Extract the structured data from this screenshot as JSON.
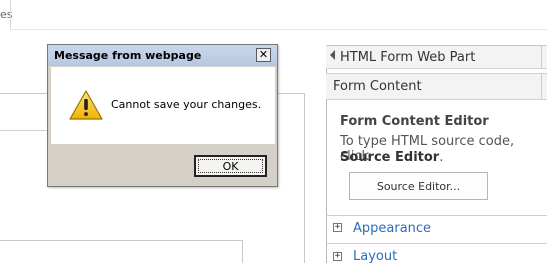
{
  "background": {
    "tab_fragment": "es"
  },
  "tool_pane": {
    "title": "HTML Form Web Part",
    "section_header": "Form Content",
    "editor_title": "Form Content Editor",
    "editor_desc_line1": "To type HTML source code, click",
    "editor_desc_bold": "Source Editor",
    "editor_desc_end": ".",
    "source_editor_button": "Source Editor...",
    "sections": [
      {
        "label": "Appearance",
        "toggle": "+"
      },
      {
        "label": "Layout",
        "toggle": "+"
      }
    ]
  },
  "dialog": {
    "title": "Message from webpage",
    "close_glyph": "✕",
    "message": "Cannot save your changes.",
    "ok_label": "OK",
    "icon": "warning-icon"
  },
  "colors": {
    "link": "#2a6ebb",
    "dialog_bg": "#d4d0c8",
    "titlebar": "#b6c8e1"
  }
}
